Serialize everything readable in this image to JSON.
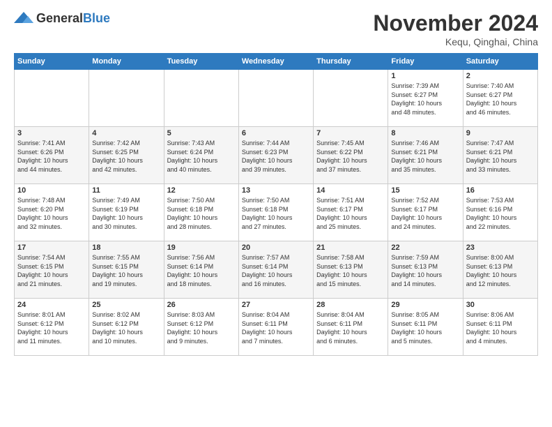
{
  "header": {
    "logo_general": "General",
    "logo_blue": "Blue",
    "title": "November 2024",
    "location": "Kequ, Qinghai, China"
  },
  "weekdays": [
    "Sunday",
    "Monday",
    "Tuesday",
    "Wednesday",
    "Thursday",
    "Friday",
    "Saturday"
  ],
  "weeks": [
    [
      {
        "day": "",
        "info": ""
      },
      {
        "day": "",
        "info": ""
      },
      {
        "day": "",
        "info": ""
      },
      {
        "day": "",
        "info": ""
      },
      {
        "day": "",
        "info": ""
      },
      {
        "day": "1",
        "info": "Sunrise: 7:39 AM\nSunset: 6:27 PM\nDaylight: 10 hours\nand 48 minutes."
      },
      {
        "day": "2",
        "info": "Sunrise: 7:40 AM\nSunset: 6:27 PM\nDaylight: 10 hours\nand 46 minutes."
      }
    ],
    [
      {
        "day": "3",
        "info": "Sunrise: 7:41 AM\nSunset: 6:26 PM\nDaylight: 10 hours\nand 44 minutes."
      },
      {
        "day": "4",
        "info": "Sunrise: 7:42 AM\nSunset: 6:25 PM\nDaylight: 10 hours\nand 42 minutes."
      },
      {
        "day": "5",
        "info": "Sunrise: 7:43 AM\nSunset: 6:24 PM\nDaylight: 10 hours\nand 40 minutes."
      },
      {
        "day": "6",
        "info": "Sunrise: 7:44 AM\nSunset: 6:23 PM\nDaylight: 10 hours\nand 39 minutes."
      },
      {
        "day": "7",
        "info": "Sunrise: 7:45 AM\nSunset: 6:22 PM\nDaylight: 10 hours\nand 37 minutes."
      },
      {
        "day": "8",
        "info": "Sunrise: 7:46 AM\nSunset: 6:21 PM\nDaylight: 10 hours\nand 35 minutes."
      },
      {
        "day": "9",
        "info": "Sunrise: 7:47 AM\nSunset: 6:21 PM\nDaylight: 10 hours\nand 33 minutes."
      }
    ],
    [
      {
        "day": "10",
        "info": "Sunrise: 7:48 AM\nSunset: 6:20 PM\nDaylight: 10 hours\nand 32 minutes."
      },
      {
        "day": "11",
        "info": "Sunrise: 7:49 AM\nSunset: 6:19 PM\nDaylight: 10 hours\nand 30 minutes."
      },
      {
        "day": "12",
        "info": "Sunrise: 7:50 AM\nSunset: 6:18 PM\nDaylight: 10 hours\nand 28 minutes."
      },
      {
        "day": "13",
        "info": "Sunrise: 7:50 AM\nSunset: 6:18 PM\nDaylight: 10 hours\nand 27 minutes."
      },
      {
        "day": "14",
        "info": "Sunrise: 7:51 AM\nSunset: 6:17 PM\nDaylight: 10 hours\nand 25 minutes."
      },
      {
        "day": "15",
        "info": "Sunrise: 7:52 AM\nSunset: 6:17 PM\nDaylight: 10 hours\nand 24 minutes."
      },
      {
        "day": "16",
        "info": "Sunrise: 7:53 AM\nSunset: 6:16 PM\nDaylight: 10 hours\nand 22 minutes."
      }
    ],
    [
      {
        "day": "17",
        "info": "Sunrise: 7:54 AM\nSunset: 6:15 PM\nDaylight: 10 hours\nand 21 minutes."
      },
      {
        "day": "18",
        "info": "Sunrise: 7:55 AM\nSunset: 6:15 PM\nDaylight: 10 hours\nand 19 minutes."
      },
      {
        "day": "19",
        "info": "Sunrise: 7:56 AM\nSunset: 6:14 PM\nDaylight: 10 hours\nand 18 minutes."
      },
      {
        "day": "20",
        "info": "Sunrise: 7:57 AM\nSunset: 6:14 PM\nDaylight: 10 hours\nand 16 minutes."
      },
      {
        "day": "21",
        "info": "Sunrise: 7:58 AM\nSunset: 6:13 PM\nDaylight: 10 hours\nand 15 minutes."
      },
      {
        "day": "22",
        "info": "Sunrise: 7:59 AM\nSunset: 6:13 PM\nDaylight: 10 hours\nand 14 minutes."
      },
      {
        "day": "23",
        "info": "Sunrise: 8:00 AM\nSunset: 6:13 PM\nDaylight: 10 hours\nand 12 minutes."
      }
    ],
    [
      {
        "day": "24",
        "info": "Sunrise: 8:01 AM\nSunset: 6:12 PM\nDaylight: 10 hours\nand 11 minutes."
      },
      {
        "day": "25",
        "info": "Sunrise: 8:02 AM\nSunset: 6:12 PM\nDaylight: 10 hours\nand 10 minutes."
      },
      {
        "day": "26",
        "info": "Sunrise: 8:03 AM\nSunset: 6:12 PM\nDaylight: 10 hours\nand 9 minutes."
      },
      {
        "day": "27",
        "info": "Sunrise: 8:04 AM\nSunset: 6:11 PM\nDaylight: 10 hours\nand 7 minutes."
      },
      {
        "day": "28",
        "info": "Sunrise: 8:04 AM\nSunset: 6:11 PM\nDaylight: 10 hours\nand 6 minutes."
      },
      {
        "day": "29",
        "info": "Sunrise: 8:05 AM\nSunset: 6:11 PM\nDaylight: 10 hours\nand 5 minutes."
      },
      {
        "day": "30",
        "info": "Sunrise: 8:06 AM\nSunset: 6:11 PM\nDaylight: 10 hours\nand 4 minutes."
      }
    ]
  ]
}
